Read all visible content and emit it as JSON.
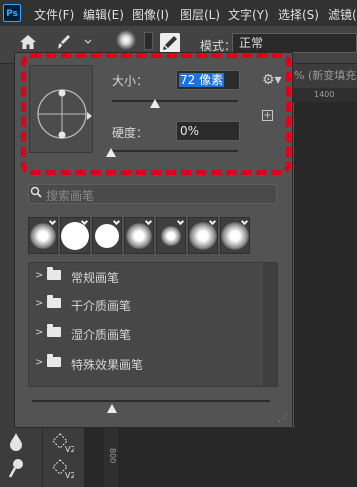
{
  "menubar": {
    "logo": "Ps",
    "items": [
      "文件(F)",
      "编辑(E)",
      "图像(I)",
      "图层(L)",
      "文字(Y)",
      "选择(S)",
      "滤镜("
    ]
  },
  "options_bar": {
    "brush_size_badge": "72",
    "mode_label": "模式：",
    "mode_value": "正常"
  },
  "doc_tab": {
    "title": "% (新变填充"
  },
  "ruler": {
    "mark": "1400"
  },
  "vruler": {
    "mark": "800"
  },
  "brush_panel": {
    "size_label": "大小：",
    "size_value_selected": "72 像素",
    "size_fraction": 0.33,
    "hardness_label": "硬度：",
    "hardness_value": "0%",
    "hardness_fraction": 0.0,
    "search_placeholder": "搜索画笔",
    "recent_brushes": [
      {
        "kind": "soft",
        "icon": "download-icon"
      },
      {
        "kind": "hard",
        "icon": "pen-icon"
      },
      {
        "kind": "hard",
        "icon": "pen-icon"
      },
      {
        "kind": "soft",
        "icon": "download-icon"
      },
      {
        "kind": "soft",
        "icon": "download-icon"
      },
      {
        "kind": "soft",
        "icon": "download-icon"
      },
      {
        "kind": "soft",
        "icon": "download-icon"
      }
    ],
    "groups": [
      "常规画笔",
      "干介质画笔",
      "湿介质画笔",
      "特殊效果画笔"
    ],
    "preview_scale_fraction": 0.35
  },
  "colors": {
    "highlight_dash": "#e0001b",
    "selection_blue": "#1d72d8",
    "panel_bg": "#535353"
  }
}
